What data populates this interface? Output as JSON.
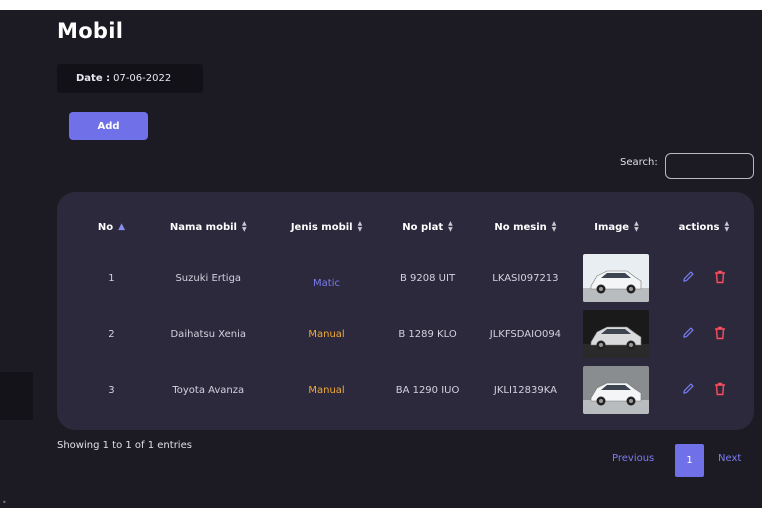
{
  "page": {
    "title": "Mobil"
  },
  "date": {
    "label": "Date :",
    "value": "07-06-2022"
  },
  "toolbar": {
    "add_label": "Add"
  },
  "search": {
    "label": "Search:",
    "value": ""
  },
  "table": {
    "columns": [
      "No",
      "Nama mobil",
      "Jenis mobil",
      "No plat",
      "No mesin",
      "Image",
      "actions"
    ],
    "sorted_column": "No",
    "rows": [
      {
        "no": "1",
        "nama": "Suzuki Ertiga",
        "jenis": "Matic",
        "plat": "B 9208 UIT",
        "mesin": "LKASI097213",
        "image_color": "#e9eef2"
      },
      {
        "no": "2",
        "nama": "Daihatsu Xenia",
        "jenis": "Manual",
        "plat": "B 1289 KLO",
        "mesin": "JLKFSDAIO094",
        "image_color": "#1a1a1a"
      },
      {
        "no": "3",
        "nama": "Toyota Avanza",
        "jenis": "Manual",
        "plat": "BA 1290 IUO",
        "mesin": "JKLI12839KA",
        "image_color": "#8a8d90"
      }
    ],
    "action_icons": [
      "pencil-icon",
      "trash-icon"
    ]
  },
  "footer": {
    "entries_info": "Showing 1 to 1 of 1 entries",
    "previous_label": "Previous",
    "current_page": "1",
    "next_label": "Next"
  },
  "colors": {
    "accent": "#7071e8",
    "manual": "#f0a93a",
    "matic": "#7b7cf0",
    "danger": "#ff4d5e",
    "background": "#1c1b24",
    "card": "#2b293b"
  }
}
